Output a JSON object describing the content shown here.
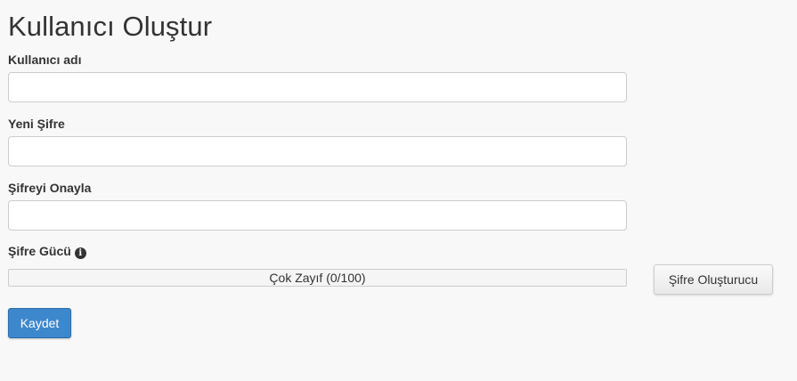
{
  "page": {
    "title": "Kullanıcı Oluştur"
  },
  "form": {
    "username": {
      "label": "Kullanıcı adı",
      "value": "",
      "placeholder": ""
    },
    "new_password": {
      "label": "Yeni Şifre",
      "value": "",
      "placeholder": ""
    },
    "confirm_password": {
      "label": "Şifreyi Onayla",
      "value": "",
      "placeholder": ""
    },
    "strength": {
      "label": "Şifre Gücü",
      "info_icon": "info-circle-icon",
      "text": "Çok Zayıf (0/100)",
      "score": 0,
      "max": 100
    },
    "generator_label": "Şifre Oluşturucu",
    "save_label": "Kaydet"
  },
  "colors": {
    "background": "#f8f8f8",
    "primary_button": "#3d87cd",
    "strength_weak": "#d9534f"
  }
}
